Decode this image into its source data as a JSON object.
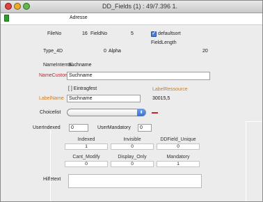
{
  "window": {
    "title": "DD_Fields (1) : 49/7.396 1."
  },
  "topbar": {
    "label": "Adresse"
  },
  "rows": {
    "fileno_label": "FileNo",
    "fileno_value": "16",
    "fieldno_label": "FieldNo",
    "fieldno_value": "5",
    "defaultsort_label": "defaultsort",
    "fieldlength_label": "FieldLength",
    "type4d_label": "Type_4D",
    "type4d_value": "0",
    "alpha_label": "Alpha",
    "fieldlength_value": "20",
    "nameinternal_label": "NameInternal",
    "nameinternal_value": "Suchname",
    "namecustom_label": "NameCustom",
    "namecustom_value": "Suchname",
    "eintragfest_label": "[ ] Eintragfest",
    "labelressource_label": "LabelRessource",
    "labelname_label": "LabelName",
    "labelname_value": "Suchname",
    "labelressource_value": "30015,5",
    "choicelist_label": "Choicelist",
    "userindexed_label": "UserIndexed",
    "userindexed_value": "0",
    "usermandatory_label": "UserMandatory",
    "usermandatory_value": "0",
    "hilfetext_label": "Hilfetext"
  },
  "flags": {
    "row1": [
      {
        "label": "Indexed",
        "value": "1"
      },
      {
        "label": "Invisible",
        "value": "0"
      },
      {
        "label": "DDField_Unique",
        "value": "0"
      }
    ],
    "row2": [
      {
        "label": "Cant_Modify",
        "value": "0"
      },
      {
        "label": "Display_Only",
        "value": "0"
      },
      {
        "label": "Mandatory",
        "value": "1"
      }
    ]
  },
  "colors": {
    "red": "#c0262a",
    "orange": "#d07a20",
    "green": "#2f9e2f"
  }
}
